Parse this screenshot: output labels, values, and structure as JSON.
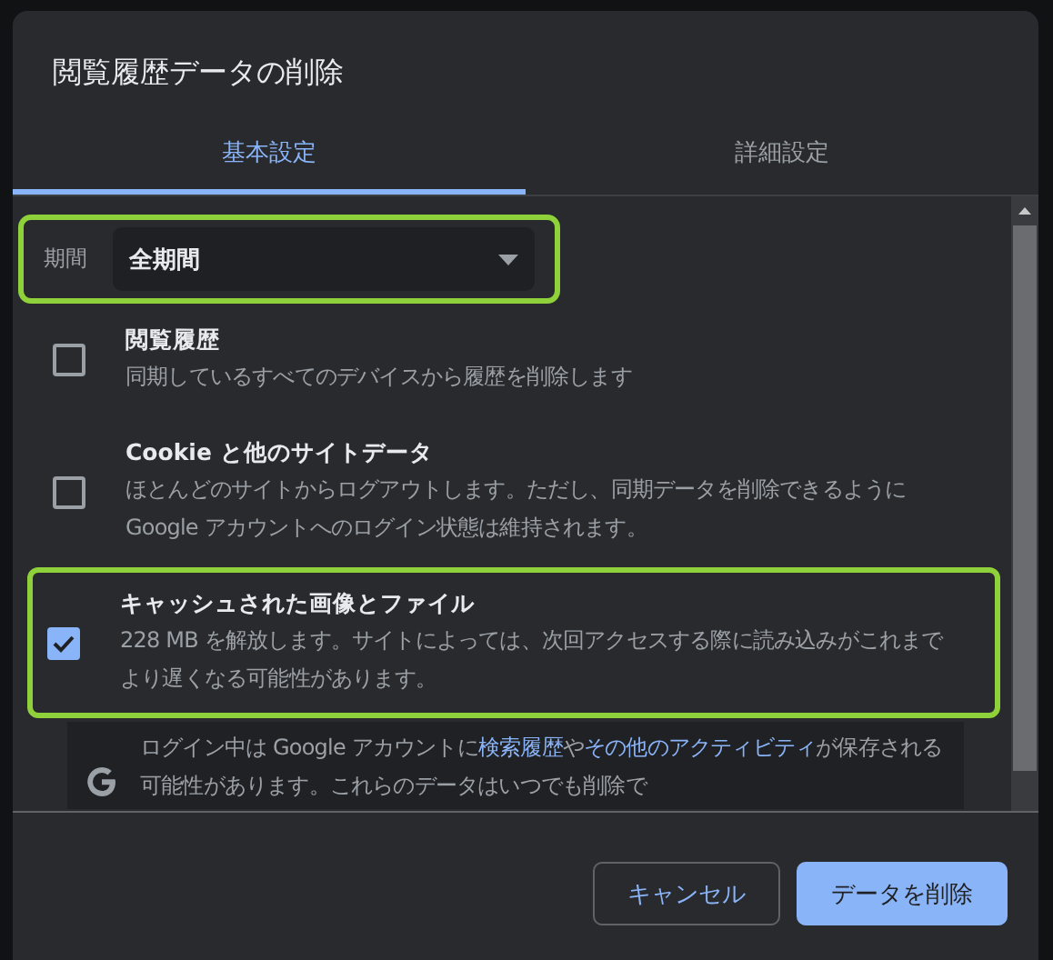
{
  "dialog": {
    "title": "閲覧履歴データの削除"
  },
  "tabs": [
    {
      "label": "基本設定",
      "selected": true
    },
    {
      "label": "詳細設定",
      "selected": false
    }
  ],
  "period": {
    "label": "期間",
    "value": "全期間",
    "highlighted": true
  },
  "items": [
    {
      "title": "閲覧履歴",
      "description": "同期しているすべてのデバイスから履歴を削除します",
      "checked": false,
      "highlighted": false
    },
    {
      "title": "Cookie と他のサイトデータ",
      "description": "ほとんどのサイトからログアウトします。ただし、同期データを削除できるように Google アカウントへのログイン状態は維持されます。",
      "checked": false,
      "highlighted": false
    },
    {
      "title": "キャッシュされた画像とファイル",
      "description": "228 MB を解放します。サイトによっては、次回アクセスする際に読み込みがこれまでより遅くなる可能性があります。",
      "checked": true,
      "highlighted": true
    }
  ],
  "note": {
    "segments": [
      {
        "text": "ログイン中は Google アカウントに",
        "link": false
      },
      {
        "text": "検索履歴",
        "link": true
      },
      {
        "text": "や",
        "link": false
      },
      {
        "text": "その他のアクティビティ",
        "link": true
      },
      {
        "text": "が保存される可能性があります。これらのデータはいつでも削除で",
        "link": false
      }
    ]
  },
  "buttons": [
    {
      "label": "キャンセル",
      "kind": "secondary"
    },
    {
      "label": "データを削除",
      "kind": "primary"
    }
  ]
}
